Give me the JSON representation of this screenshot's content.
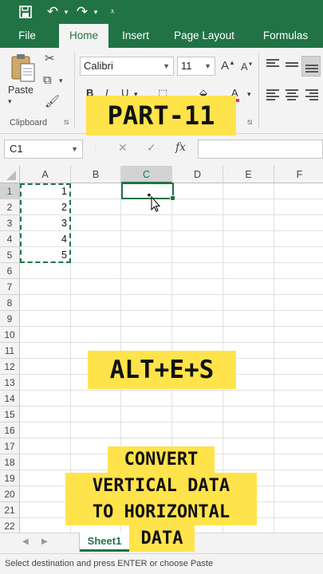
{
  "quick_access": {
    "save_icon": "save-icon",
    "undo_icon": "undo-icon",
    "redo_icon": "redo-icon",
    "customize_icon": "customize-qat-icon"
  },
  "ribbon_tabs": [
    {
      "label": "File"
    },
    {
      "label": "Home"
    },
    {
      "label": "Insert"
    },
    {
      "label": "Page Layout"
    },
    {
      "label": "Formulas"
    }
  ],
  "home": {
    "paste_label": "Paste",
    "clipboard_label": "Clipboard",
    "font_name": "Calibri",
    "font_size": "11",
    "grow_font": "A",
    "shrink_font": "A",
    "bold": "B",
    "italic": "I",
    "underline": "U",
    "font_color_glyph": "A",
    "font_color": "#e03b3b"
  },
  "formula_bar": {
    "name_box": "C1",
    "cancel": "✕",
    "enter": "✓",
    "fx": "fx",
    "value": ""
  },
  "columns": [
    "A",
    "B",
    "C",
    "D",
    "E",
    "F"
  ],
  "selected_column": "C",
  "rows": [
    "1",
    "2",
    "3",
    "4",
    "5",
    "6",
    "7",
    "8",
    "9",
    "10",
    "11",
    "12",
    "13",
    "14",
    "15",
    "16",
    "17",
    "18",
    "19",
    "20",
    "21",
    "22"
  ],
  "selected_row": "1",
  "cells": {
    "A1": "1",
    "A2": "2",
    "A3": "3",
    "A4": "4",
    "A5": "5"
  },
  "sheets": [
    {
      "name": "Sheet1"
    }
  ],
  "status_text": "Select destination and press ENTER or choose Paste",
  "overlays": {
    "part": "PART-11",
    "shortcut": "ALT+E+S",
    "caption_lines": [
      "CONVERT",
      "VERTICAL DATA",
      "TO HORIZONTAL",
      "DATA"
    ]
  },
  "colors": {
    "accent": "#217346",
    "overlay": "#ffe34a"
  }
}
